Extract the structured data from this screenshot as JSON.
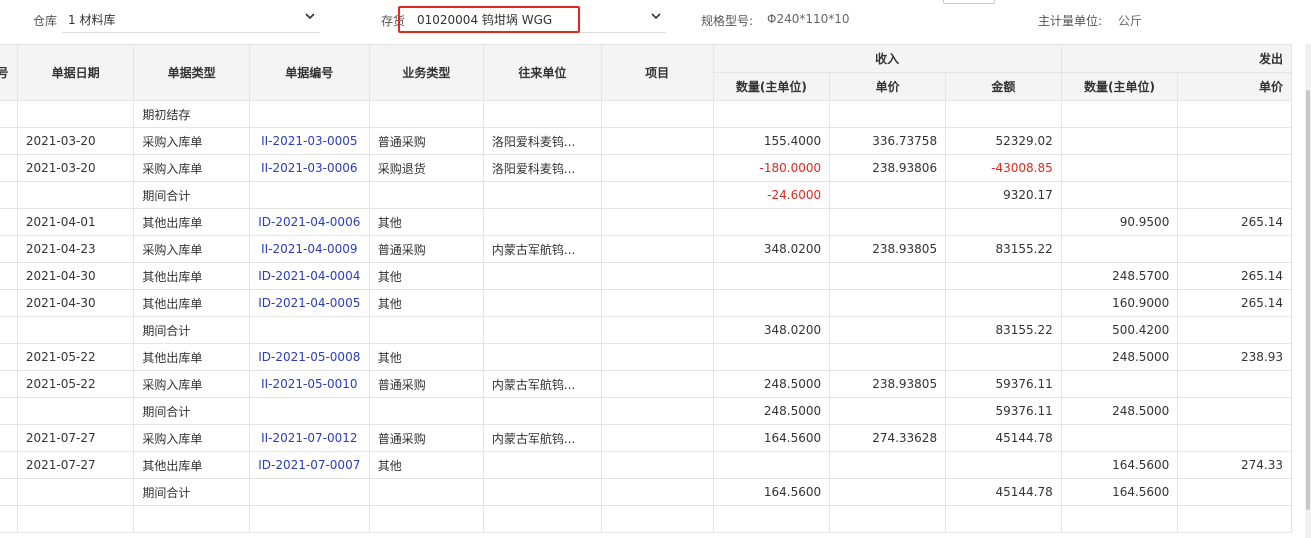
{
  "filters": {
    "warehouse_label": "仓库",
    "warehouse_value": "1 材料库",
    "stock_label": "存货",
    "stock_value": "01020004 钨坩埚 WGG",
    "spec_label": "规格型号:",
    "spec_value": "Φ240*110*10",
    "unit_label": "主计量单位:",
    "unit_value": "公斤"
  },
  "icons": {
    "dropdown": "chevron-down-icon"
  },
  "colors": {
    "link": "#2b3cbc",
    "negative": "#e0281e",
    "highlight_box": "#e0281e",
    "header_bg": "#f4f4f4"
  },
  "table": {
    "headers": {
      "seq": "号",
      "date": "单据日期",
      "doc_type": "单据类型",
      "doc_no": "单据编号",
      "biz_type": "业务类型",
      "partner": "往来单位",
      "project": "项目",
      "receive_group": "收入",
      "issue_group": "发出",
      "r_qty": "数量(主单位)",
      "r_price": "单价",
      "r_amount": "金额",
      "i_qty": "数量(主单位)",
      "i_price": "单价"
    },
    "rows": [
      {
        "date": "",
        "type": "期初结存",
        "no": "",
        "biz": "",
        "partner": "",
        "project": "",
        "r_qty": "",
        "r_price": "",
        "r_amount": "",
        "i_qty": "",
        "i_price": ""
      },
      {
        "date": "2021-03-20",
        "type": "采购入库单",
        "no": "II-2021-03-0005",
        "biz": "普通采购",
        "partner": "洛阳爱科麦钨...",
        "project": "",
        "r_qty": "155.4000",
        "r_price": "336.73758",
        "r_amount": "52329.02",
        "i_qty": "",
        "i_price": ""
      },
      {
        "date": "2021-03-20",
        "type": "采购入库单",
        "no": "II-2021-03-0006",
        "biz": "采购退货",
        "partner": "洛阳爱科麦钨...",
        "project": "",
        "r_qty": "-180.0000",
        "r_price": "238.93806",
        "r_amount": "-43008.85",
        "i_qty": "",
        "i_price": ""
      },
      {
        "date": "",
        "type": "期间合计",
        "no": "",
        "biz": "",
        "partner": "",
        "project": "",
        "r_qty": "-24.6000",
        "r_price": "",
        "r_amount": "9320.17",
        "i_qty": "",
        "i_price": ""
      },
      {
        "date": "2021-04-01",
        "type": "其他出库单",
        "no": "ID-2021-04-0006",
        "biz": "其他",
        "partner": "",
        "project": "",
        "r_qty": "",
        "r_price": "",
        "r_amount": "",
        "i_qty": "90.9500",
        "i_price": "265.14"
      },
      {
        "date": "2021-04-23",
        "type": "采购入库单",
        "no": "II-2021-04-0009",
        "biz": "普通采购",
        "partner": "内蒙古军航钨...",
        "project": "",
        "r_qty": "348.0200",
        "r_price": "238.93805",
        "r_amount": "83155.22",
        "i_qty": "",
        "i_price": ""
      },
      {
        "date": "2021-04-30",
        "type": "其他出库单",
        "no": "ID-2021-04-0004",
        "biz": "其他",
        "partner": "",
        "project": "",
        "r_qty": "",
        "r_price": "",
        "r_amount": "",
        "i_qty": "248.5700",
        "i_price": "265.14"
      },
      {
        "date": "2021-04-30",
        "type": "其他出库单",
        "no": "ID-2021-04-0005",
        "biz": "其他",
        "partner": "",
        "project": "",
        "r_qty": "",
        "r_price": "",
        "r_amount": "",
        "i_qty": "160.9000",
        "i_price": "265.14"
      },
      {
        "date": "",
        "type": "期间合计",
        "no": "",
        "biz": "",
        "partner": "",
        "project": "",
        "r_qty": "348.0200",
        "r_price": "",
        "r_amount": "83155.22",
        "i_qty": "500.4200",
        "i_price": ""
      },
      {
        "date": "2021-05-22",
        "type": "其他出库单",
        "no": "ID-2021-05-0008",
        "biz": "其他",
        "partner": "",
        "project": "",
        "r_qty": "",
        "r_price": "",
        "r_amount": "",
        "i_qty": "248.5000",
        "i_price": "238.93"
      },
      {
        "date": "2021-05-22",
        "type": "采购入库单",
        "no": "II-2021-05-0010",
        "biz": "普通采购",
        "partner": "内蒙古军航钨...",
        "project": "",
        "r_qty": "248.5000",
        "r_price": "238.93805",
        "r_amount": "59376.11",
        "i_qty": "",
        "i_price": ""
      },
      {
        "date": "",
        "type": "期间合计",
        "no": "",
        "biz": "",
        "partner": "",
        "project": "",
        "r_qty": "248.5000",
        "r_price": "",
        "r_amount": "59376.11",
        "i_qty": "248.5000",
        "i_price": ""
      },
      {
        "date": "2021-07-27",
        "type": "采购入库单",
        "no": "II-2021-07-0012",
        "biz": "普通采购",
        "partner": "内蒙古军航钨...",
        "project": "",
        "r_qty": "164.5600",
        "r_price": "274.33628",
        "r_amount": "45144.78",
        "i_qty": "",
        "i_price": ""
      },
      {
        "date": "2021-07-27",
        "type": "其他出库单",
        "no": "ID-2021-07-0007",
        "biz": "其他",
        "partner": "",
        "project": "",
        "r_qty": "",
        "r_price": "",
        "r_amount": "",
        "i_qty": "164.5600",
        "i_price": "274.33"
      },
      {
        "date": "",
        "type": "期间合计",
        "no": "",
        "biz": "",
        "partner": "",
        "project": "",
        "r_qty": "164.5600",
        "r_price": "",
        "r_amount": "45144.78",
        "i_qty": "164.5600",
        "i_price": ""
      },
      {
        "date": "",
        "type": "",
        "no": "",
        "biz": "",
        "partner": "",
        "project": "",
        "r_qty": "",
        "r_price": "",
        "r_amount": "",
        "i_qty": "",
        "i_price": ""
      }
    ]
  }
}
